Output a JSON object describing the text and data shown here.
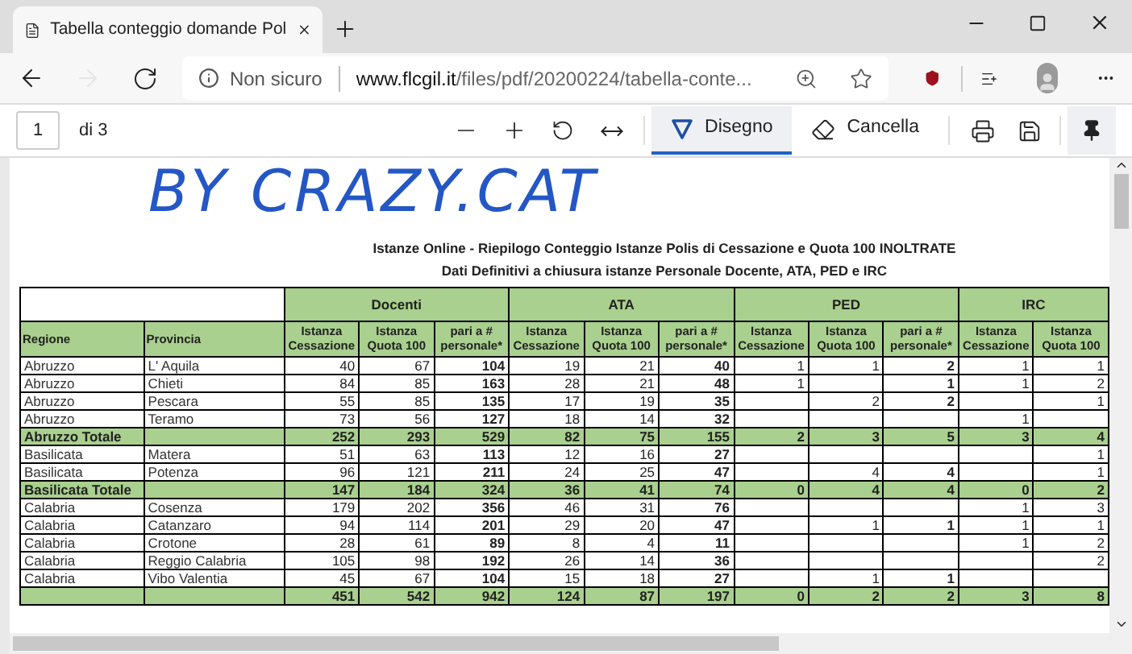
{
  "tab": {
    "title": "Tabella conteggio domande Pol"
  },
  "address": {
    "security": "Non sicuro",
    "domain": "www.flcgil.it",
    "path": "/files/pdf/20200224/tabella-conte..."
  },
  "nav": {
    "forward_disabled": true
  },
  "pdf_toolbar": {
    "page": "1",
    "page_count": "di 3",
    "tools": [
      {
        "label": "Disegno",
        "kind": "draw",
        "selected": true
      },
      {
        "label": "Cancella",
        "kind": "erase",
        "selected": false
      }
    ]
  },
  "document": {
    "ink_annotation": "BY CRAZY.CAT",
    "title": "Istanze Online - Riepilogo Conteggio Istanze Polis di Cessazione e Quota 100  INOLTRATE",
    "subtitle": "Dati Definitivi a chiusura istanze Personale Docente, ATA, PED e IRC",
    "table": {
      "groups": [
        {
          "label": "Docenti"
        },
        {
          "label": "ATA"
        },
        {
          "label": "PED"
        },
        {
          "label": "IRC"
        }
      ],
      "columns": [
        "Regione",
        "Provincia",
        "Istanza Cessazione",
        "Istanza Quota 100",
        "pari a # personale*",
        "Istanza Cessazione",
        "Istanza Quota 100",
        "pari a # personale*",
        "Istanza Cessazione",
        "Istanza Quota 100",
        "pari a # personale*",
        "Istanza Cessazione",
        "Istanza Quota 100"
      ],
      "rows": [
        {
          "kind": "data",
          "cells": [
            "Abruzzo",
            "L' Aquila",
            "40",
            "67",
            "104",
            "19",
            "21",
            "40",
            "1",
            "1",
            "2",
            "1",
            "1"
          ]
        },
        {
          "kind": "data",
          "cells": [
            "Abruzzo",
            "Chieti",
            "84",
            "85",
            "163",
            "28",
            "21",
            "48",
            "1",
            null,
            "1",
            "1",
            "2"
          ]
        },
        {
          "kind": "data",
          "cells": [
            "Abruzzo",
            "Pescara",
            "55",
            "85",
            "135",
            "17",
            "19",
            "35",
            null,
            "2",
            "2",
            null,
            "1"
          ]
        },
        {
          "kind": "data",
          "cells": [
            "Abruzzo",
            "Teramo",
            "73",
            "56",
            "127",
            "18",
            "14",
            "32",
            null,
            null,
            null,
            "1",
            null
          ]
        },
        {
          "kind": "total",
          "cells": [
            "Abruzzo Totale",
            null,
            "252",
            "293",
            "529",
            "82",
            "75",
            "155",
            "2",
            "3",
            "5",
            "3",
            "4"
          ]
        },
        {
          "kind": "data",
          "cells": [
            "Basilicata",
            "Matera",
            "51",
            "63",
            "113",
            "12",
            "16",
            "27",
            null,
            null,
            null,
            null,
            "1"
          ]
        },
        {
          "kind": "data",
          "cells": [
            "Basilicata",
            "Potenza",
            "96",
            "121",
            "211",
            "24",
            "25",
            "47",
            null,
            "4",
            "4",
            null,
            "1"
          ]
        },
        {
          "kind": "total",
          "cells": [
            "Basilicata Totale",
            null,
            "147",
            "184",
            "324",
            "36",
            "41",
            "74",
            "0",
            "4",
            "4",
            "0",
            "2"
          ]
        },
        {
          "kind": "data",
          "cells": [
            "Calabria",
            "Cosenza",
            "179",
            "202",
            "356",
            "46",
            "31",
            "76",
            null,
            null,
            null,
            "1",
            "3"
          ]
        },
        {
          "kind": "data",
          "cells": [
            "Calabria",
            "Catanzaro",
            "94",
            "114",
            "201",
            "29",
            "20",
            "47",
            null,
            "1",
            "1",
            "1",
            "1"
          ]
        },
        {
          "kind": "data",
          "cells": [
            "Calabria",
            "Crotone",
            "28",
            "61",
            "89",
            "8",
            "4",
            "11",
            null,
            null,
            null,
            "1",
            "2"
          ]
        },
        {
          "kind": "data",
          "cells": [
            "Calabria",
            "Reggio Calabria",
            "105",
            "98",
            "192",
            "26",
            "14",
            "36",
            null,
            null,
            null,
            null,
            "2"
          ]
        },
        {
          "kind": "data",
          "cells": [
            "Calabria",
            "Vibo Valentia",
            "45",
            "67",
            "104",
            "15",
            "18",
            "27",
            null,
            "1",
            "1",
            null,
            null
          ]
        },
        {
          "kind": "total",
          "cells": [
            null,
            null,
            "451",
            "542",
            "942",
            "124",
            "87",
            "197",
            "0",
            "2",
            "2",
            "3",
            "8"
          ]
        }
      ]
    }
  }
}
